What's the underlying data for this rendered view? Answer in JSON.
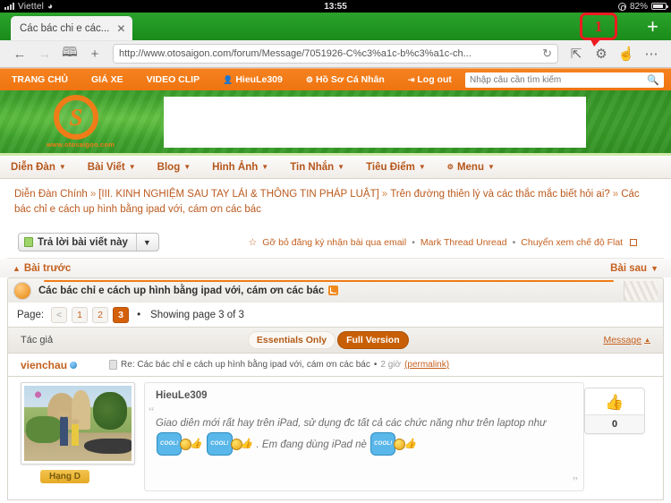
{
  "status_bar": {
    "carrier": "Viettel",
    "wifi_icon": "wifi-icon",
    "time": "13:55",
    "lock_icon": "rotation-lock-icon",
    "battery_pct": "82%"
  },
  "browser": {
    "tab": {
      "title": "Các bác chi e các...",
      "close_icon": "close-icon"
    },
    "new_tab_icon": "plus-icon",
    "back_icon": "arrow-left-icon",
    "forward_icon": "arrow-right-icon",
    "bookmarks_icon": "book-icon",
    "add_icon": "plus-icon",
    "url": "http://www.otosaigon.com/forum/Message/7051926-C%c3%a1c-b%c3%a1c-ch...",
    "reload_icon": "reload-icon",
    "share_icon": "share-icon",
    "settings_icon": "gear-icon",
    "hand_icon": "hand-pointer-icon",
    "more_icon": "ellipsis-icon"
  },
  "annotation": {
    "label": "1",
    "color": "#ee1b22",
    "target": "gear-icon"
  },
  "site_nav": {
    "items": [
      {
        "label": "TRANG CHỦ",
        "icon": ""
      },
      {
        "label": "GIÁ XE",
        "icon": ""
      },
      {
        "label": "VIDEO CLIP",
        "icon": ""
      },
      {
        "label": "HieuLe309",
        "icon": "user-icon"
      },
      {
        "label": "Hồ Sơ Cá Nhân",
        "icon": "gear-icon"
      },
      {
        "label": "Log out",
        "icon": "logout-icon"
      }
    ],
    "search": {
      "placeholder": "Nhập câu cần tìm kiếm",
      "value": "",
      "icon": "search-icon"
    }
  },
  "banner": {
    "logo_letter": "S",
    "logo_url": "www.otosaigon.com"
  },
  "forum_menu": {
    "items": [
      {
        "label": "Diễn Đàn",
        "icon": ""
      },
      {
        "label": "Bài Viết",
        "icon": ""
      },
      {
        "label": "Blog",
        "icon": ""
      },
      {
        "label": "Hình Ảnh",
        "icon": ""
      },
      {
        "label": "Tin Nhắn",
        "icon": ""
      },
      {
        "label": "Tiêu Điểm",
        "icon": ""
      },
      {
        "label": "Menu",
        "icon": "gears-icon"
      }
    ]
  },
  "breadcrumb": {
    "items": [
      "Diễn Đàn Chính",
      "[III. KINH NGHIỆM SAU TAY LÁI & THÔNG TIN PHÁP LUẬT]",
      "Trên đường thiên lý và các thắc mắc biết hỏi ai?",
      "Các bác chỉ e cách up hình bằng ipad với, cám ơn các bác"
    ],
    "separator": "»"
  },
  "reply_row": {
    "reply_label": "Trả lời bài viết này",
    "dropdown_icon": "chevron-down-icon",
    "options": [
      {
        "label": "Gỡ bỏ đăng ký nhận bài qua email",
        "icon": "star-icon"
      },
      {
        "label": "Mark Thread Unread",
        "icon": ""
      },
      {
        "label": "Chuyển xem chế độ Flat",
        "icon": "checkbox-icon"
      }
    ],
    "separator": "•"
  },
  "prev_next": {
    "prev_label": "Bài trước",
    "prev_icon": "chevron-up-icon",
    "next_label": "Bài sau",
    "next_icon": "chevron-down-icon"
  },
  "thread": {
    "title": "Các bác chỉ e cách up hình bằng ipad với, cám ơn các bác",
    "rss_icon": "rss-icon",
    "avatar_icon": "avatar"
  },
  "pagination": {
    "label": "Page:",
    "prev": "<",
    "pages": [
      "1",
      "2",
      "3"
    ],
    "active": "3",
    "bullet": "•",
    "showing": "Showing page 3 of 3"
  },
  "author_bar": {
    "author_label": "Tác giả",
    "essentials_label": "Essentials Only",
    "full_version_label": "Full Version",
    "message_label": "Message",
    "message_icon": "triangle-up-icon"
  },
  "post": {
    "username": "vienchau",
    "online_icon": "online-status-icon",
    "doc_icon": "post-icon",
    "subject": "Re: Các bác chỉ e cách up hình bằng ipad với, cám ơn các bác",
    "bullet": "•",
    "time": "2 giờ",
    "permalink": "(permalink)",
    "avatar_name": "Hạng D",
    "photo_icon": "user-photo"
  },
  "quote": {
    "author": "HieuLe309",
    "open_quote": "“",
    "close_quote": "”",
    "text_part1": "Giao diên mới rất hay trên iPad, sử dụng đc tất cả các chức năng như trên laptop như",
    "emoticon_label": "COOL!",
    "text_part2": ". Em đang dùng iPad nè"
  },
  "like": {
    "icon": "thumbs-up-icon",
    "count": "0"
  }
}
